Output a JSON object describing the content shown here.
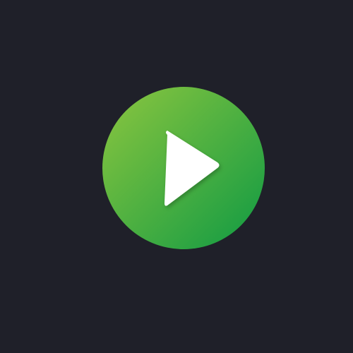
{
  "player": {
    "play_button": {
      "icon": "play-icon",
      "colors": {
        "background": "#1f2029",
        "gradient_start": "#8cc63f",
        "gradient_end": "#0f9a43",
        "icon": "#ffffff"
      }
    }
  }
}
